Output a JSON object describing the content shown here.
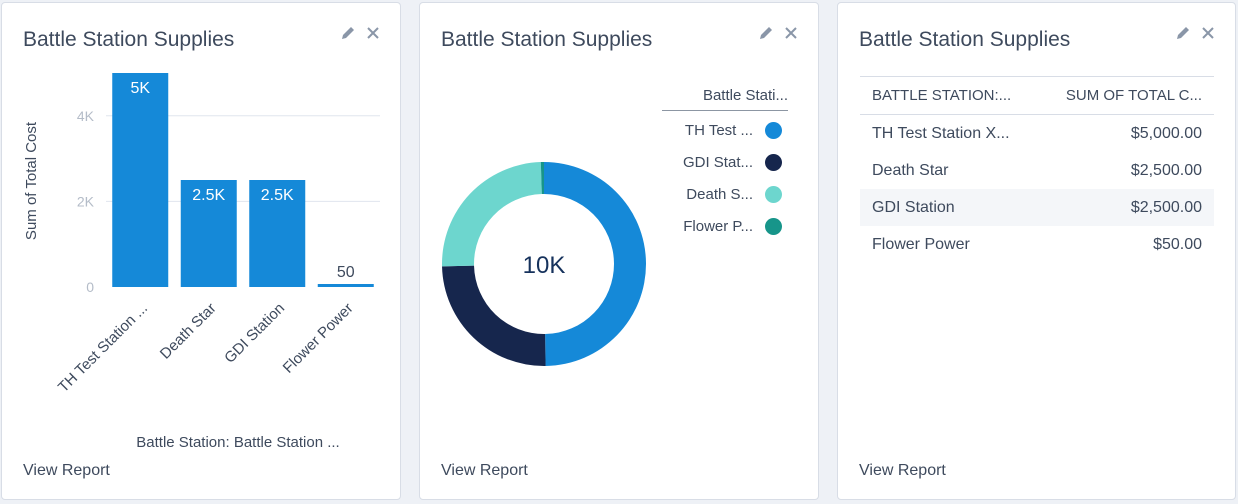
{
  "cards": [
    {
      "title": "Battle Station Supplies",
      "view_report": "View Report"
    },
    {
      "title": "Battle Station Supplies",
      "view_report": "View Report"
    },
    {
      "title": "Battle Station Supplies",
      "view_report": "View Report"
    }
  ],
  "icons": {
    "edit": "pencil-icon",
    "close": "close-icon"
  },
  "colors": {
    "bar": "#1589d8",
    "donut": [
      "#1589d8",
      "#16264d",
      "#6dd6ce",
      "#17958a"
    ],
    "text": "#3e4a5d",
    "grid": "#e0e5ee"
  },
  "chart_data": [
    {
      "type": "bar",
      "categories": [
        "TH Test Station ...",
        "Death Star",
        "GDI Station",
        "Flower Power"
      ],
      "values": [
        5000,
        2500,
        2500,
        50
      ],
      "data_labels": [
        "5K",
        "2.5K",
        "2.5K",
        "50"
      ],
      "ylabel": "Sum of Total Cost",
      "xlabel": "Battle Station: Battle Station ...",
      "yticks": [
        0,
        2000,
        4000
      ],
      "ytick_labels": [
        "0",
        "2K",
        "4K"
      ],
      "ylim": [
        0,
        5000
      ],
      "grid": true
    },
    {
      "type": "pie",
      "categories": [
        "TH Test ...",
        "GDI Stat...",
        "Death S...",
        "Flower P..."
      ],
      "values": [
        5000,
        2500,
        2500,
        50
      ],
      "center_label": "10K",
      "legend_title": "Battle Stati...",
      "legend_position": "right"
    },
    {
      "type": "table",
      "columns": [
        "BATTLE STATION:...",
        "SUM OF TOTAL C..."
      ],
      "rows": [
        [
          "TH Test Station X...",
          "$5,000.00"
        ],
        [
          "Death Star",
          "$2,500.00"
        ],
        [
          "GDI Station",
          "$2,500.00"
        ],
        [
          "Flower Power",
          "$50.00"
        ]
      ]
    }
  ]
}
